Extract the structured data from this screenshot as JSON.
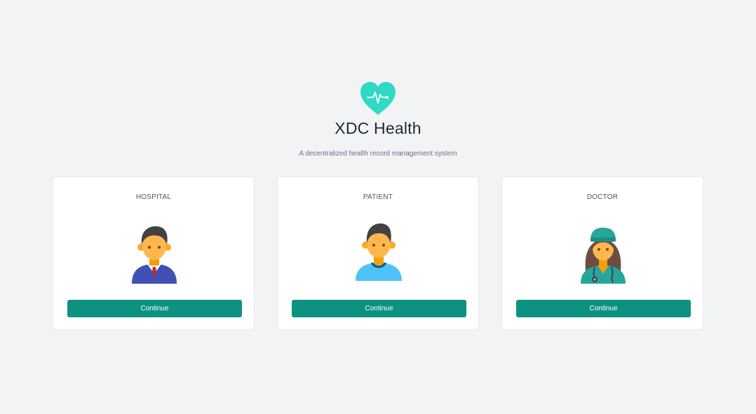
{
  "brand": {
    "title": "XDC Health",
    "subtitle": "A decentralized health record management system",
    "logo_icon": "heart-pulse-icon",
    "logo_color": "#2fd9c5"
  },
  "cards": [
    {
      "title": "HOSPITAL",
      "avatar_icon": "hospital-admin-avatar-icon",
      "button_label": "Continue"
    },
    {
      "title": "PATIENT",
      "avatar_icon": "patient-avatar-icon",
      "button_label": "Continue"
    },
    {
      "title": "DOCTOR",
      "avatar_icon": "doctor-avatar-icon",
      "button_label": "Continue"
    }
  ],
  "colors": {
    "background": "#f2f3f5",
    "card": "#ffffff",
    "button": "#0d9282",
    "button_text": "#ffffff"
  }
}
